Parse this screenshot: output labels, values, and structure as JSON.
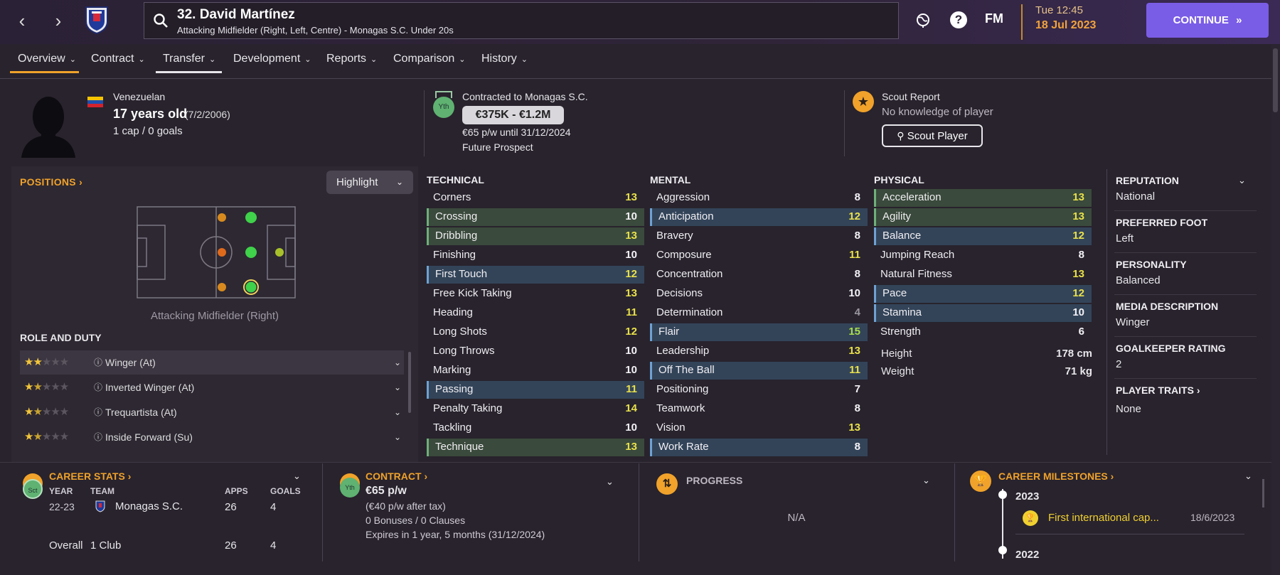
{
  "topbar": {
    "player_title": "32. David Martínez",
    "player_subtitle": "Attacking Midfielder (Right, Left, Centre) - Monagas S.C. Under 20s",
    "fm_label": "FM",
    "time": "Tue 12:45",
    "date": "18 Jul 2023",
    "continue_label": "CONTINUE"
  },
  "tabs": [
    {
      "label": "Overview"
    },
    {
      "label": "Contract"
    },
    {
      "label": "Transfer"
    },
    {
      "label": "Development"
    },
    {
      "label": "Reports"
    },
    {
      "label": "Comparison"
    },
    {
      "label": "History"
    }
  ],
  "header": {
    "nationality": "Venezuelan",
    "age": "17 years old",
    "dob": "(7/2/2006)",
    "caps": "1 cap / 0 goals",
    "contract_badge": "Yth",
    "contracted_to": "Contracted to Monagas S.C.",
    "value_range": "€375K - €1.2M",
    "wage": "€65 p/w until 31/12/2024",
    "prospect": "Future Prospect",
    "scout_title": "Scout Report",
    "scout_status": "No knowledge of player",
    "scout_button": "Scout Player"
  },
  "positions": {
    "title": "POSITIONS",
    "highlight_label": "Highlight",
    "selected_position": "Attacking Midfielder (Right)",
    "role_duty_title": "ROLE AND DUTY",
    "roles": [
      {
        "label": "Winger (At)",
        "stars": 2
      },
      {
        "label": "Inverted Winger (At)",
        "stars": 1.5
      },
      {
        "label": "Trequartista (At)",
        "stars": 1.5
      },
      {
        "label": "Inside Forward (Su)",
        "stars": 1.5
      }
    ]
  },
  "attributes": {
    "technical_title": "TECHNICAL",
    "mental_title": "MENTAL",
    "physical_title": "PHYSICAL",
    "technical": [
      {
        "name": "Corners",
        "value": "13"
      },
      {
        "name": "Crossing",
        "value": "10"
      },
      {
        "name": "Dribbling",
        "value": "13"
      },
      {
        "name": "Finishing",
        "value": "10"
      },
      {
        "name": "First Touch",
        "value": "12"
      },
      {
        "name": "Free Kick Taking",
        "value": "13"
      },
      {
        "name": "Heading",
        "value": "11"
      },
      {
        "name": "Long Shots",
        "value": "12"
      },
      {
        "name": "Long Throws",
        "value": "10"
      },
      {
        "name": "Marking",
        "value": "10"
      },
      {
        "name": "Passing",
        "value": "11"
      },
      {
        "name": "Penalty Taking",
        "value": "14"
      },
      {
        "name": "Tackling",
        "value": "10"
      },
      {
        "name": "Technique",
        "value": "13"
      }
    ],
    "mental": [
      {
        "name": "Aggression",
        "value": "8"
      },
      {
        "name": "Anticipation",
        "value": "12"
      },
      {
        "name": "Bravery",
        "value": "8"
      },
      {
        "name": "Composure",
        "value": "11"
      },
      {
        "name": "Concentration",
        "value": "8"
      },
      {
        "name": "Decisions",
        "value": "10"
      },
      {
        "name": "Determination",
        "value": "4"
      },
      {
        "name": "Flair",
        "value": "15"
      },
      {
        "name": "Leadership",
        "value": "13"
      },
      {
        "name": "Off The Ball",
        "value": "11"
      },
      {
        "name": "Positioning",
        "value": "7"
      },
      {
        "name": "Teamwork",
        "value": "8"
      },
      {
        "name": "Vision",
        "value": "13"
      },
      {
        "name": "Work Rate",
        "value": "8"
      }
    ],
    "physical": [
      {
        "name": "Acceleration",
        "value": "13"
      },
      {
        "name": "Agility",
        "value": "13"
      },
      {
        "name": "Balance",
        "value": "12"
      },
      {
        "name": "Jumping Reach",
        "value": "8"
      },
      {
        "name": "Natural Fitness",
        "value": "13"
      },
      {
        "name": "Pace",
        "value": "12"
      },
      {
        "name": "Stamina",
        "value": "10"
      },
      {
        "name": "Strength",
        "value": "6"
      }
    ],
    "height_label": "Height",
    "height": "178 cm",
    "weight_label": "Weight",
    "weight": "71 kg"
  },
  "profile": {
    "reputation_title": "REPUTATION",
    "reputation": "National",
    "foot_title": "PREFERRED FOOT",
    "foot": "Left",
    "personality_title": "PERSONALITY",
    "personality": "Balanced",
    "media_title": "MEDIA DESCRIPTION",
    "media": "Winger",
    "gk_title": "GOALKEEPER RATING",
    "gk": "2",
    "traits_title": "PLAYER TRAITS",
    "traits": "None"
  },
  "career_stats": {
    "title": "CAREER STATS",
    "badge": "Sct",
    "col_year": "YEAR",
    "col_team": "TEAM",
    "col_apps": "APPS",
    "col_goals": "GOALS",
    "year": "22-23",
    "team": "Monagas S.C.",
    "apps": "26",
    "goals": "4",
    "overall_label": "Overall",
    "overall_team": "1 Club",
    "overall_apps": "26",
    "overall_goals": "4"
  },
  "contract_panel": {
    "title": "CONTRACT",
    "badge": "Yth",
    "wage": "€65 p/w",
    "after_tax": "(€40 p/w after tax)",
    "bonuses": "0 Bonuses / 0 Clauses",
    "expires": "Expires in 1 year, 5 months (31/12/2024)"
  },
  "progress_panel": {
    "title": "PROGRESS",
    "value": "N/A"
  },
  "milestones": {
    "title": "CAREER MILESTONES",
    "year1": "2023",
    "item1": "First international cap...",
    "item1_date": "18/6/2023",
    "year2": "2022"
  },
  "colors": {
    "accent_orange": "#f0a22a",
    "continue_purple": "#7a5de6",
    "attr_yellow": "#e9e14a",
    "attr_green": "#a9df4a"
  }
}
